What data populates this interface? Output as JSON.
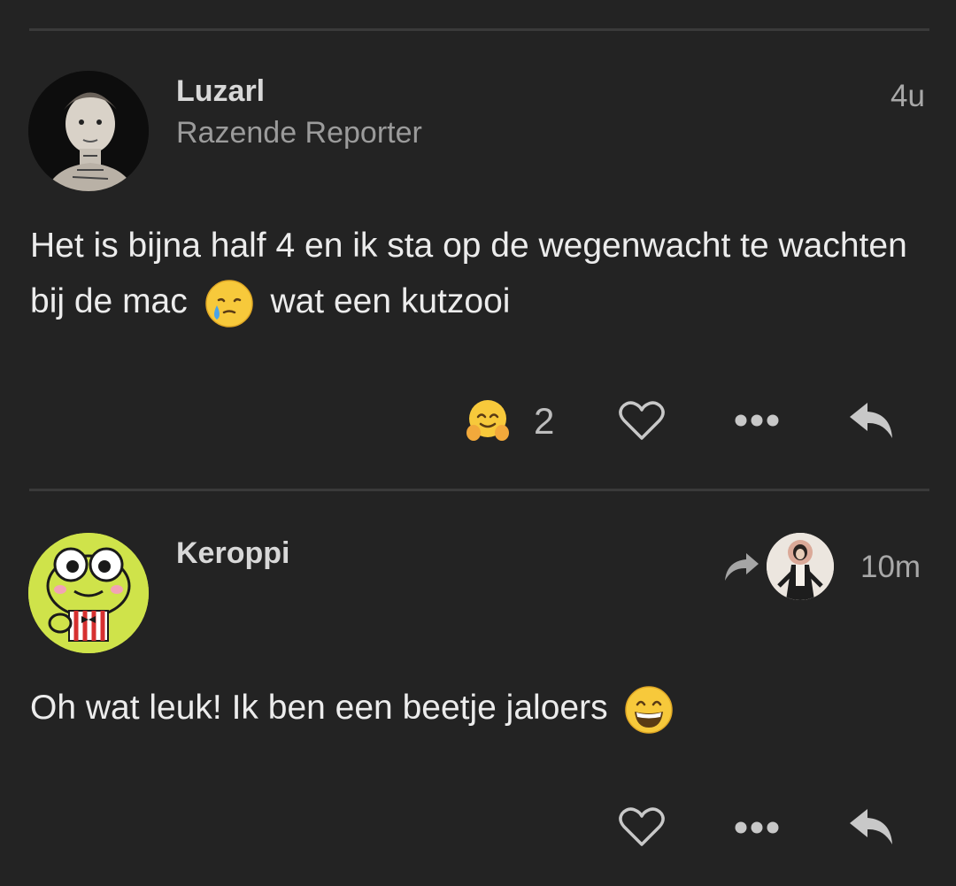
{
  "posts": [
    {
      "username": "Luzarl",
      "role": "Razende Reporter",
      "time": "4u",
      "text_part1": "Het is bijna half 4 en ik sta op de wegenwacht te wachten bij de mac",
      "text_part2": "wat een kutzooi",
      "inline_emoji": "crying-face",
      "reaction_emoji": "hugging-face",
      "reaction_count": "2"
    },
    {
      "username": "Keroppi",
      "time": "10m",
      "text": "Oh wat leuk! Ik ben een beetje jaloers",
      "inline_emoji": "grinning-face",
      "reply_to_avatar": "small-avatar"
    }
  ],
  "colors": {
    "background": "#232323",
    "divider": "#3a3a3a",
    "icon": "#c8c8c8",
    "muted": "#9b9b9b"
  }
}
